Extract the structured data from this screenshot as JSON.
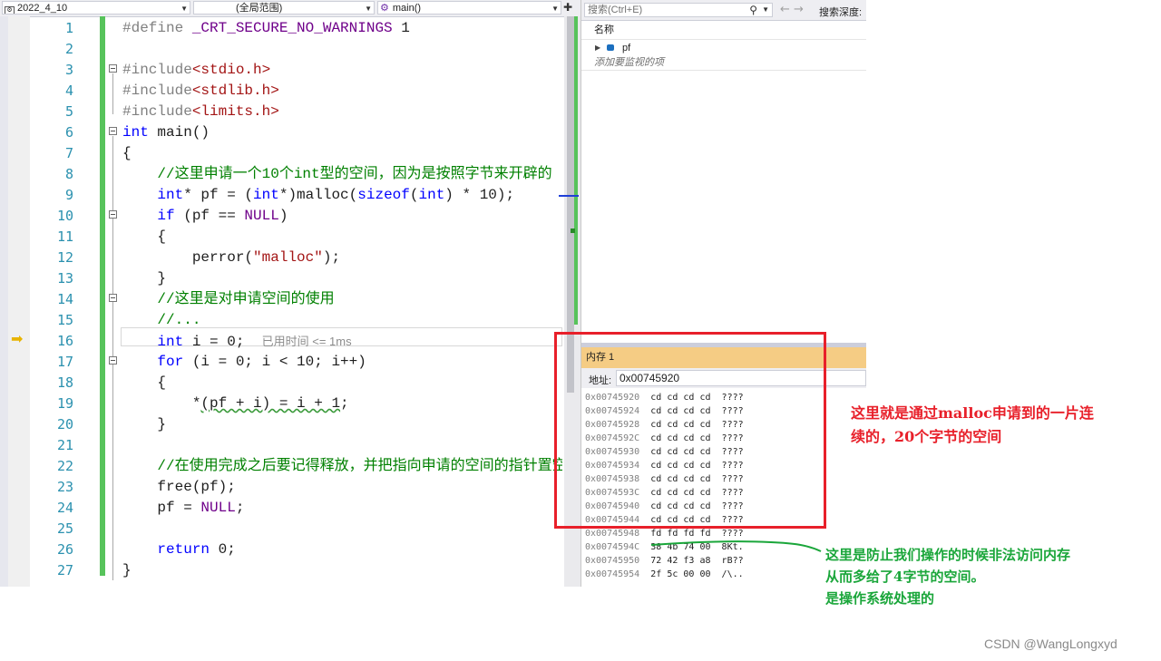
{
  "nav": {
    "project": "2022_4_10",
    "scope": "(全局范围)",
    "function": "main()"
  },
  "editor": {
    "line_numbers": [
      "1",
      "2",
      "3",
      "4",
      "5",
      "6",
      "7",
      "8",
      "9",
      "10",
      "11",
      "12",
      "13",
      "14",
      "15",
      "16",
      "17",
      "18",
      "19",
      "20",
      "21",
      "22",
      "23",
      "24",
      "25",
      "26",
      "27"
    ],
    "current_line_hint": "已用时间 <= 1ms"
  },
  "watch": {
    "search_placeholder": "搜索(Ctrl+E)",
    "search_depth_label": "搜索深度:",
    "column_name": "名称",
    "item_name": "pf",
    "add_item_hint": "添加要监视的项"
  },
  "memory": {
    "title": "内存 1",
    "address_label": "地址:",
    "address_value": "0x00745920",
    "rows": [
      {
        "addr": "0x00745920",
        "bytes": "cd cd cd cd",
        "ascii": "????"
      },
      {
        "addr": "0x00745924",
        "bytes": "cd cd cd cd",
        "ascii": "????"
      },
      {
        "addr": "0x00745928",
        "bytes": "cd cd cd cd",
        "ascii": "????"
      },
      {
        "addr": "0x0074592C",
        "bytes": "cd cd cd cd",
        "ascii": "????"
      },
      {
        "addr": "0x00745930",
        "bytes": "cd cd cd cd",
        "ascii": "????"
      },
      {
        "addr": "0x00745934",
        "bytes": "cd cd cd cd",
        "ascii": "????"
      },
      {
        "addr": "0x00745938",
        "bytes": "cd cd cd cd",
        "ascii": "????"
      },
      {
        "addr": "0x0074593C",
        "bytes": "cd cd cd cd",
        "ascii": "????"
      },
      {
        "addr": "0x00745940",
        "bytes": "cd cd cd cd",
        "ascii": "????"
      },
      {
        "addr": "0x00745944",
        "bytes": "cd cd cd cd",
        "ascii": "????"
      },
      {
        "addr": "0x00745948",
        "bytes": "fd fd fd fd",
        "ascii": "????"
      },
      {
        "addr": "0x0074594C",
        "bytes": "38 4b 74 00",
        "ascii": "8Kt."
      },
      {
        "addr": "0x00745950",
        "bytes": "72 42 f3 a8",
        "ascii": "rB??"
      },
      {
        "addr": "0x00745954",
        "bytes": "2f 5c 00 00",
        "ascii": "/\\.."
      }
    ]
  },
  "annotations": {
    "red_note_line1": "这里就是通过malloc申请到的一片连",
    "red_note_line2": "续的，20个字节的空间",
    "green_note_line1": "这里是防止我们操作的时候非法访问内存",
    "green_note_line2": "从而多给了4字节的空间。",
    "green_note_line3": "是操作系统处理的",
    "red_color": "#e8202a",
    "green_color": "#1aa63a"
  },
  "watermark": "CSDN @WangLongxyd"
}
